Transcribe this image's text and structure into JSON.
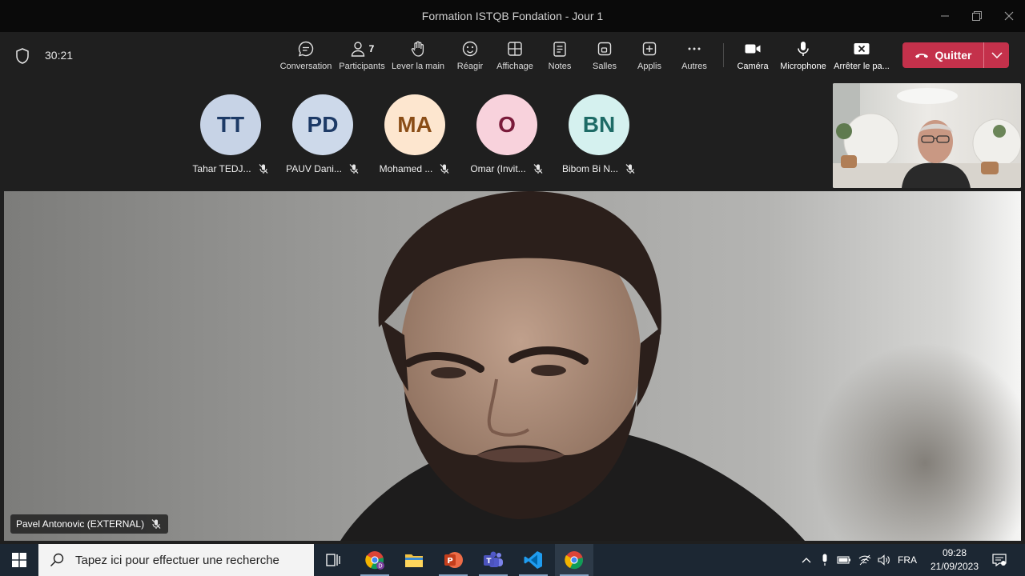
{
  "window": {
    "title": "Formation ISTQB Fondation - Jour 1"
  },
  "toolbar": {
    "timer": "30:21",
    "participants_count": "7",
    "buttons": {
      "conversation": "Conversation",
      "participants": "Participants",
      "raise_hand": "Lever la main",
      "react": "Réagir",
      "view": "Affichage",
      "notes": "Notes",
      "rooms": "Salles",
      "apps": "Applis",
      "more": "Autres",
      "camera": "Caméra",
      "microphone": "Microphone",
      "stop_share": "Arrêter le pa..."
    },
    "leave_label": "Quitter",
    "leave_color": "#c4314b"
  },
  "participants": [
    {
      "initials": "TT",
      "name": "Tahar TEDJ...",
      "bg": "#c7d3e6",
      "fg": "#1d3a66"
    },
    {
      "initials": "PD",
      "name": "PAUV Dani...",
      "bg": "#cdd9ea",
      "fg": "#1d3a66"
    },
    {
      "initials": "MA",
      "name": "Mohamed ...",
      "bg": "#fde6cf",
      "fg": "#8a4d16"
    },
    {
      "initials": "O",
      "name": "Omar (Invit...",
      "bg": "#f8d2dc",
      "fg": "#7a1b3a"
    },
    {
      "initials": "BN",
      "name": "Bibom Bi N...",
      "bg": "#d5f1ef",
      "fg": "#1d6b66"
    }
  ],
  "main_video": {
    "speaker_name": "Pavel Antonovic (EXTERNAL)"
  },
  "taskbar": {
    "search_placeholder": "Tapez ici pour effectuer une recherche",
    "language": "FRA",
    "time": "09:28",
    "date": "21/09/2023"
  }
}
